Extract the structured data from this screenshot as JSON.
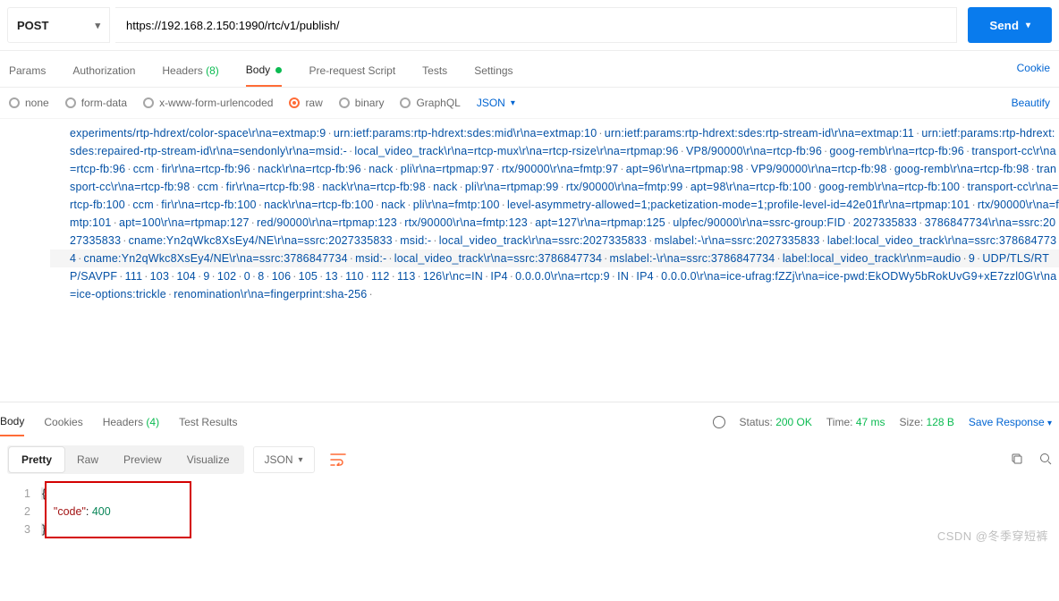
{
  "request": {
    "method": "POST",
    "url": "https://192.168.2.150:1990/rtc/v1/publish/",
    "send_label": "Send"
  },
  "tabs": {
    "params": "Params",
    "authorization": "Authorization",
    "headers": "Headers",
    "headers_count": "(8)",
    "body": "Body",
    "prerequest": "Pre-request Script",
    "tests": "Tests",
    "settings": "Settings",
    "cookies_link": "Cookie"
  },
  "body_types": {
    "none": "none",
    "formdata": "form-data",
    "xwww": "x-www-form-urlencoded",
    "raw": "raw",
    "binary": "binary",
    "graphql": "GraphQL",
    "format": "JSON",
    "beautify": "Beautify"
  },
  "editor_text": "experiments/rtp-hdrext/color-space\\r\\na=extmap:9·urn:ietf:params:rtp-hdrext:sdes:mid\\r\\na=extmap:10·urn:ietf:params:rtp-hdrext:sdes:rtp-stream-id\\r\\na=extmap:11·urn:ietf:params:rtp-hdrext:sdes:repaired-rtp-stream-id\\r\\na=sendonly\\r\\na=msid:-·local_video_track\\r\\na=rtcp-mux\\r\\na=rtcp-rsize\\r\\na=rtpmap:96·VP8/90000\\r\\na=rtcp-fb:96·goog-remb\\r\\na=rtcp-fb:96·transport-cc\\r\\na=rtcp-fb:96·ccm·fir\\r\\na=rtcp-fb:96·nack\\r\\na=rtcp-fb:96·nack·pli\\r\\na=rtpmap:97·rtx/90000\\r\\na=fmtp:97·apt=96\\r\\na=rtpmap:98·VP9/90000\\r\\na=rtcp-fb:98·goog-remb\\r\\na=rtcp-fb:98·transport-cc\\r\\na=rtcp-fb:98·ccm·fir\\r\\na=rtcp-fb:98·nack\\r\\na=rtcp-fb:98·nack·pli\\r\\na=rtpmap:99·rtx/90000\\r\\na=fmtp:99·apt=98\\r\\na=rtcp-fb:100·goog-remb\\r\\na=rtcp-fb:100·transport-cc\\r\\na=rtcp-fb:100·ccm·fir\\r\\na=rtcp-fb:100·nack\\r\\na=rtcp-fb:100·nack·pli\\r\\na=fmtp:100·level-asymmetry-allowed=1;packetization-mode=1;profile-level-id=42e01f\\r\\na=rtpmap:101·rtx/90000\\r\\na=fmtp:101·apt=100\\r\\na=rtpmap:127·red/90000\\r\\na=rtpmap:123·rtx/90000\\r\\na=fmtp:123·apt=127\\r\\na=rtpmap:125·ulpfec/90000\\r\\na=ssrc-group:FID·2027335833·3786847734\\r\\na=ssrc:2027335833·cname:Yn2qWkc8XsEy4/NE\\r\\na=ssrc:2027335833·msid:-·local_video_track\\r\\na=ssrc:2027335833·mslabel:-\\r\\na=ssrc:2027335833·label:local_video_track\\r\\na=ssrc:3786847734·cname:Yn2qWkc8XsEy4/NE\\r\\na=ssrc:3786847734·msid:-·local_video_track\\r\\na=ssrc:3786847734·mslabel:-\\r\\na=ssrc:3786847734·label:local_video_track\\r\\nm=audio·9·UDP/TLS/RTP/SAVPF·111·103·104·9·102·0·8·106·105·13·110·112·113·126\\r\\nc=IN·IP4·0.0.0.0\\r\\na=rtcp:9·IN·IP4·0.0.0.0\\r\\na=ice-ufrag:fZZj\\r\\na=ice-pwd:EkODWy5bRokUvG9+xE7zzl0G\\r\\na=ice-options:trickle·renomination\\r\\na=fingerprint:sha-256·",
  "response": {
    "tabs": {
      "body": "Body",
      "cookies": "Cookies",
      "headers": "Headers",
      "headers_count": "(4)",
      "test_results": "Test Results"
    },
    "status_label": "Status:",
    "status_value": "200 OK",
    "time_label": "Time:",
    "time_value": "47 ms",
    "size_label": "Size:",
    "size_value": "128 B",
    "save_link": "Save Response",
    "view": {
      "pretty": "Pretty",
      "raw": "Raw",
      "preview": "Preview",
      "visualize": "Visualize",
      "format": "JSON"
    },
    "body_lines": {
      "l1": "{",
      "l2_key": "\"code\"",
      "l2_sep": ": ",
      "l2_val": "400",
      "l3": "}"
    }
  },
  "watermark": "CSDN @冬季穿短裤"
}
